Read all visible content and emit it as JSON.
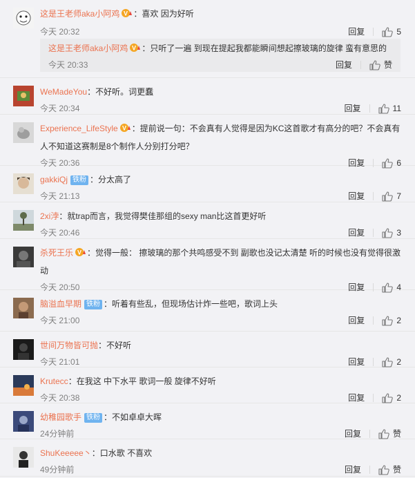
{
  "comments": [
    {
      "username": "这是王老师aka小阿鸡",
      "vip": true,
      "tie": false,
      "text": "：喜欢 因为好听",
      "time": "今天 20:32",
      "reply": "回复",
      "likes": "5",
      "avatar": "cartoon"
    },
    {
      "username": "WeMadeYou",
      "vip": false,
      "tie": false,
      "text": "：不好听。词更蠢",
      "time": "今天 20:34",
      "reply": "回复",
      "likes": "11",
      "avatar": "red"
    },
    {
      "username": "Experience_LifeStyle",
      "vip": true,
      "tie": false,
      "text": "：提前说一句：不会真有人觉得是因为KC这首歌才有高分的吧？不会真有人不知道这赛制是8个制作人分别打分吧？",
      "time": "今天 20:36",
      "reply": "回复",
      "likes": "6",
      "avatar": "gray"
    },
    {
      "username": "gakkiQj",
      "vip": false,
      "tie": true,
      "tie_label": "铁粉",
      "text": "：分太高了",
      "time": "今天 21:13",
      "reply": "回复",
      "likes": "7",
      "avatar": "face"
    },
    {
      "username": "2xi浡",
      "vip": false,
      "tie": false,
      "text": "：就trap而言，我觉得樊佳那组的sexy man比这首更好听",
      "time": "今天 20:46",
      "reply": "回复",
      "likes": "3",
      "avatar": "tree"
    },
    {
      "username": "杀死王乐",
      "vip": true,
      "tie": false,
      "text": "：觉得一般： 擦玻璃的那个共鸣感受不到 副歌也没记太清楚 听的时候也没有觉得很激动",
      "time": "今天 20:50",
      "reply": "回复",
      "likes": "4",
      "avatar": "dark"
    },
    {
      "username": "脑溢血早期",
      "vip": false,
      "tie": true,
      "tie_label": "铁粉",
      "text": "：听着有些乱，但现场估计炸一些吧，歌词上头",
      "time": "今天 21:00",
      "reply": "回复",
      "likes": "2",
      "avatar": "sepia"
    },
    {
      "username": "世间万物皆可抛",
      "vip": false,
      "tie": false,
      "text": "：不好听",
      "time": "今天 21:01",
      "reply": "回复",
      "likes": "2",
      "avatar": "black"
    },
    {
      "username": "Krutecc",
      "vip": false,
      "tie": false,
      "text": "：在我这 中下水平 歌词一般 旋律不好听",
      "time": "今天 20:38",
      "reply": "回复",
      "likes": "2",
      "avatar": "sunset"
    },
    {
      "username": "幼稚园歌手",
      "vip": false,
      "tie": true,
      "tie_label": "铁粉",
      "text": "：不如卓卓大晖",
      "time": "24分钟前",
      "reply": "回复",
      "likes": "赞",
      "avatar": "blue"
    },
    {
      "username": "ShuKeeeee丶",
      "vip": false,
      "tie": false,
      "text": "：口水歌  不喜欢",
      "time": "49分钟前",
      "reply": "回复",
      "likes": "赞",
      "avatar": "person"
    }
  ],
  "sub_reply": {
    "username": "这是王老师aka小阿鸡",
    "vip": true,
    "text": "：只听了一遍 到现在提起我都能瞬间想起擦玻璃的旋律 蛮有意思的",
    "time": "今天 20:33",
    "reply": "回复",
    "likes": "赞"
  },
  "colors": {
    "username": "#eb7350",
    "time": "#808080",
    "tie_badge": "#6fb3ef",
    "background": "#f2f2f5"
  }
}
